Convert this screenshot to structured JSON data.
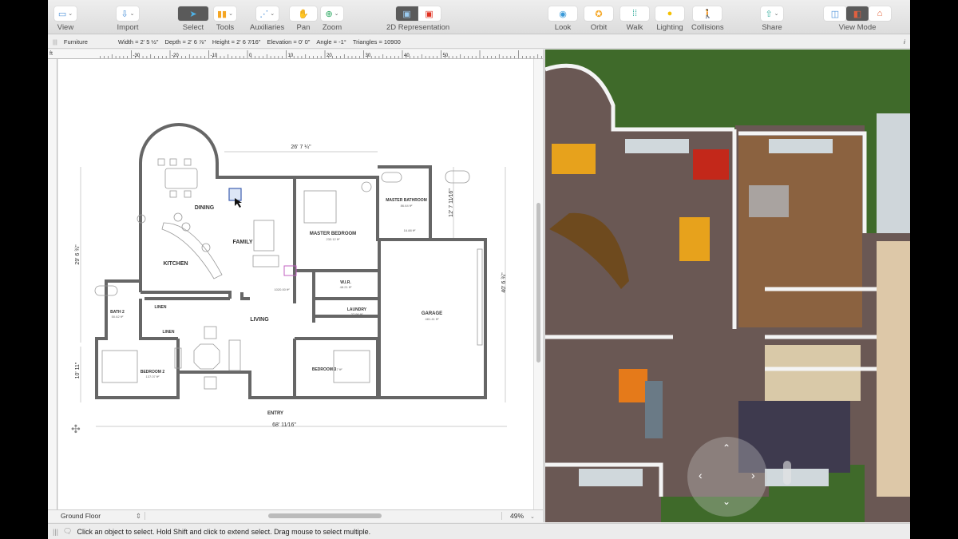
{
  "toolbar": {
    "items": [
      {
        "label": "View",
        "icon": "view-icon"
      },
      {
        "label": "Import",
        "icon": "import-icon"
      },
      {
        "label": "Select",
        "icon": "arrow-cursor-icon"
      },
      {
        "label": "Tools",
        "icon": "tools-icon"
      },
      {
        "label": "Auxiliaries",
        "icon": "auxiliaries-icon"
      },
      {
        "label": "Pan",
        "icon": "hand-icon"
      },
      {
        "label": "Zoom",
        "icon": "zoom-icon"
      },
      {
        "label": "2D Representation",
        "icon": "2d-representation-icon"
      },
      {
        "label": "Look",
        "icon": "eye-icon"
      },
      {
        "label": "Orbit",
        "icon": "orbit-icon"
      },
      {
        "label": "Walk",
        "icon": "footprints-icon"
      },
      {
        "label": "Lighting",
        "icon": "lightbulb-icon"
      },
      {
        "label": "Collisions",
        "icon": "collisions-icon"
      },
      {
        "label": "Share",
        "icon": "share-icon"
      },
      {
        "label": "View Mode",
        "icon": "view-mode-icon"
      }
    ]
  },
  "infobar": {
    "type": "Furniture",
    "width": "Width = 2' 5 ½\"",
    "depth": "Depth = 2' 6 ⅞\"",
    "height": "Height = 2' 6 7⁄16\"",
    "elevation": "Elevation = 0' 0\"",
    "angle": "Angle = -1°",
    "triangles": "Triangles = 10900",
    "info": "i"
  },
  "ruler": {
    "unit": "ft",
    "ticks": [
      "-30",
      "-20",
      "-10",
      "0",
      "10",
      "20",
      "30",
      "40",
      "50"
    ]
  },
  "plan": {
    "rooms": {
      "dining": "DINING",
      "family": "FAMILY",
      "kitchen": "KITCHEN",
      "master_bedroom": "MASTER BEDROOM",
      "master_bedroom_area": "233.12 ft²",
      "master_bathroom": "MASTER BATHROOM",
      "master_bathroom_area": "86.64 ft²",
      "wc_area": "16.88 ft²",
      "wir": "W.I.R.",
      "wir_area": "48.21 ft²",
      "laundry": "LAUNDRY",
      "laundry_area": "27.96 ft²",
      "garage": "GARAGE",
      "garage_area": "481.41 ft²",
      "bath2": "BATH 2",
      "bath2_area": "50.62 ft²",
      "linen1": "LINEN",
      "linen2": "LINEN",
      "living": "LIVING",
      "living_area": "1020.00 ft²",
      "bedroom2": "BEDROOM 2",
      "bedroom2_area": "137.07 ft²",
      "bedroom3": "BEDROOM 3",
      "bedroom3_area": "117 ft²",
      "entry": "ENTRY"
    },
    "dimensions": {
      "top": "26' 7 ¼\"",
      "left": "29' 6 ¾\"",
      "left_lower": "10' 11\"",
      "right_upper": "12' 7 11⁄16\"",
      "right": "40' 6 ¾\"",
      "bottom": "68' 11⁄16\""
    }
  },
  "bottombar": {
    "level": "Ground Floor",
    "zoom": "49%"
  },
  "status": {
    "message": "Click an object to select. Hold Shift and click to extend select. Drag mouse to select multiple."
  }
}
